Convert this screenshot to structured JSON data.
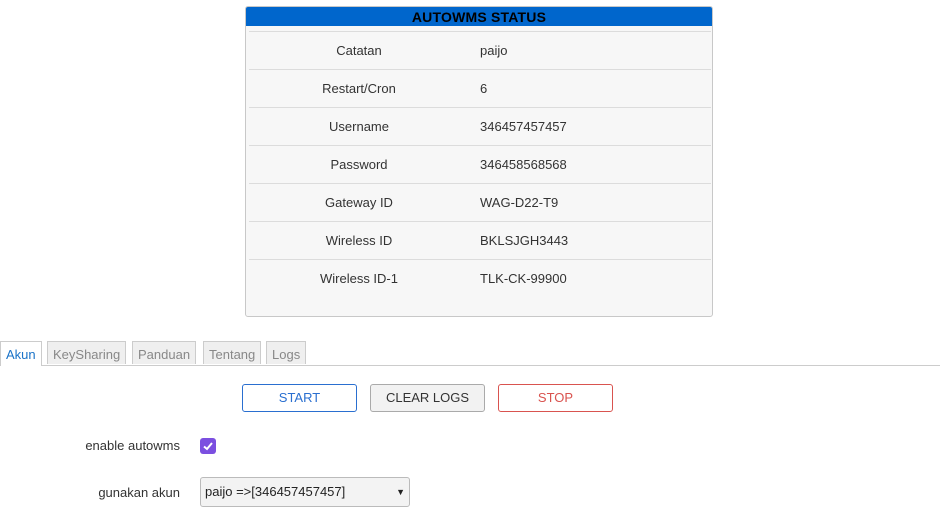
{
  "status": {
    "title": "AUTOWMS STATUS",
    "rows": [
      {
        "key": "Catatan",
        "value": "paijo"
      },
      {
        "key": "Restart/Cron",
        "value": "6"
      },
      {
        "key": "Username",
        "value": "346457457457"
      },
      {
        "key": "Password",
        "value": "346458568568"
      },
      {
        "key": "Gateway ID",
        "value": "WAG-D22-T9"
      },
      {
        "key": "Wireless ID",
        "value": "BKLSJGH3443"
      },
      {
        "key": "Wireless ID-1",
        "value": "TLK-CK-99900"
      }
    ]
  },
  "tabs": [
    "Akun",
    "KeySharing",
    "Panduan",
    "Tentang",
    "Logs"
  ],
  "buttons": {
    "start": "START",
    "clear": "CLEAR LOGS",
    "stop": "STOP"
  },
  "form": {
    "enable_label": "enable autowms",
    "enable_checked": true,
    "akun_label": "gunakan akun",
    "akun_selected": "paijo =>[346457457457]"
  },
  "icons": {
    "checkbox": "check-icon",
    "dropdown": "chevron-down-icon"
  },
  "colors": {
    "header": "#0066cc",
    "accent": "#7b4fe0",
    "start": "#2a6fd0",
    "stop": "#d9534f"
  }
}
